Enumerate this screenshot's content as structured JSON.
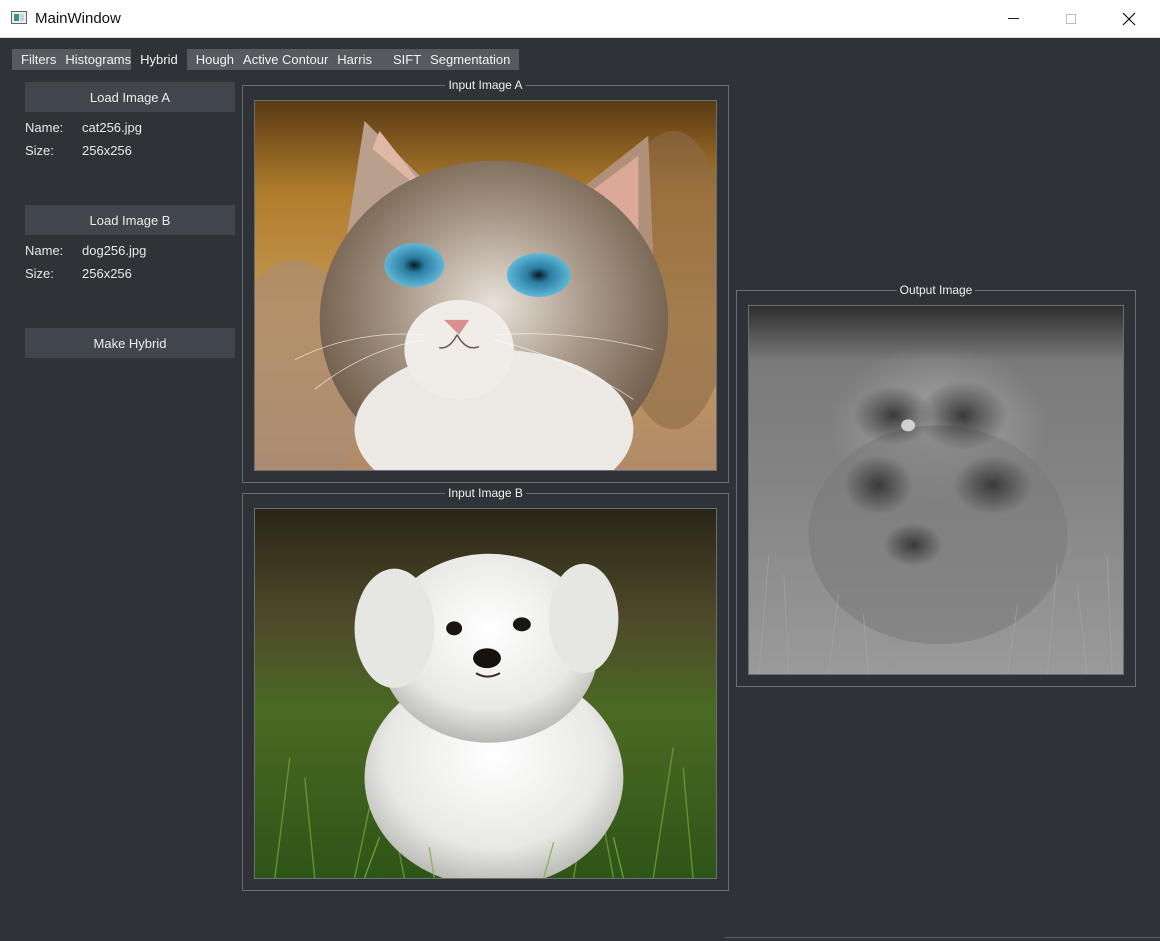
{
  "window": {
    "title": "MainWindow"
  },
  "tabs": [
    {
      "label": "Filters",
      "active": false
    },
    {
      "label": "Histograms",
      "active": false
    },
    {
      "label": "Hybrid",
      "active": true
    },
    {
      "label": "Hough",
      "active": false
    },
    {
      "label": "Active Contour",
      "active": false
    },
    {
      "label": "Harris",
      "active": false
    },
    {
      "label": "SIFT",
      "active": false
    },
    {
      "label": "Segmentation",
      "active": false
    }
  ],
  "sidebar": {
    "load_a_label": "Load Image A",
    "image_a": {
      "name_label": "Name:",
      "name": "cat256.jpg",
      "size_label": "Size:",
      "size": "256x256"
    },
    "load_b_label": "Load Image B",
    "image_b": {
      "name_label": "Name:",
      "name": "dog256.jpg",
      "size_label": "Size:",
      "size": "256x256"
    },
    "make_hybrid_label": "Make Hybrid"
  },
  "panels": {
    "input_a_title": "Input Image A",
    "input_b_title": "Input Image B",
    "output_title": "Output Image"
  },
  "colors": {
    "background": "#2f3338",
    "button": "#41464c",
    "tabbar": "#555a60"
  }
}
